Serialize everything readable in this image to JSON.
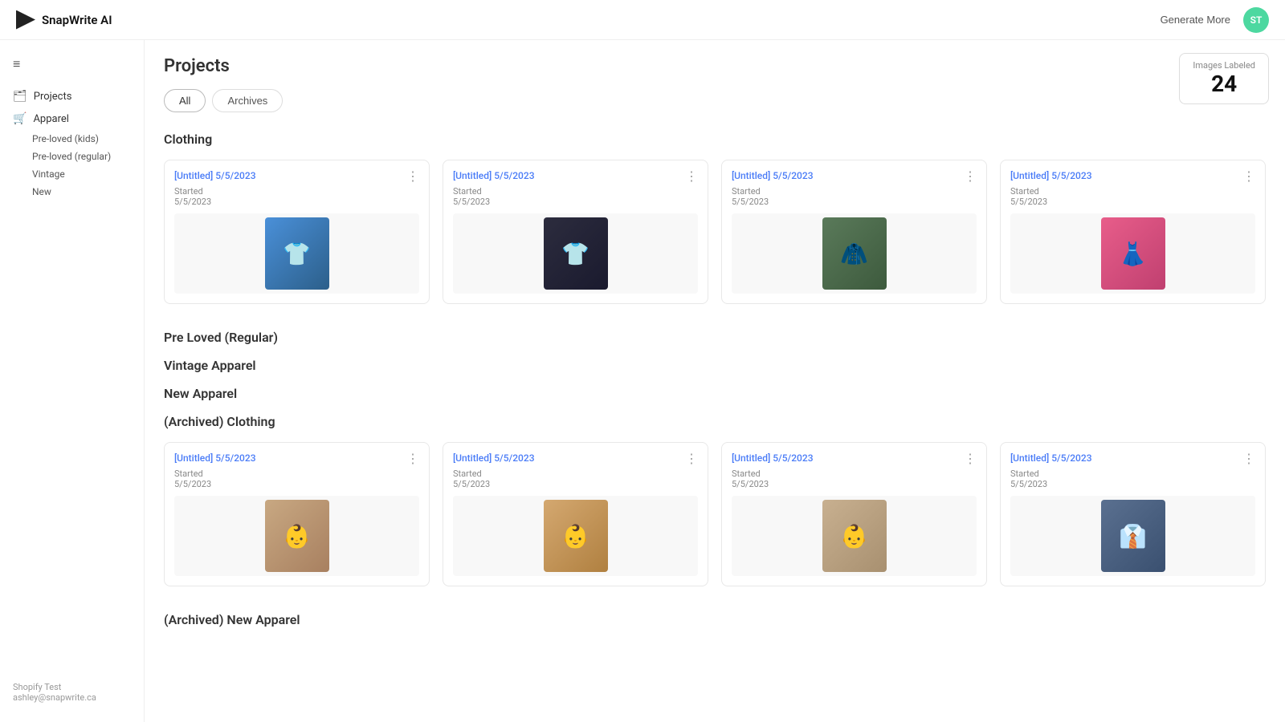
{
  "app": {
    "name": "SnapWrite AI",
    "logo_alt": "play-icon"
  },
  "header": {
    "generate_more_label": "Generate More",
    "avatar_initials": "ST"
  },
  "sidebar": {
    "menu_icon": "≡",
    "items": [
      {
        "id": "projects",
        "label": "Projects",
        "icon": "folder"
      },
      {
        "id": "apparel",
        "label": "Apparel",
        "icon": "cart"
      }
    ],
    "sub_items": [
      {
        "id": "pre-loved-kids",
        "label": "Pre-loved (kids)"
      },
      {
        "id": "pre-loved-regular",
        "label": "Pre-loved (regular)"
      },
      {
        "id": "vintage",
        "label": "Vintage"
      },
      {
        "id": "new",
        "label": "New"
      }
    ],
    "footer": {
      "store": "Shopify Test",
      "email": "ashley@snapwrite.ca"
    }
  },
  "main": {
    "page_title": "Projects",
    "tabs": [
      {
        "id": "all",
        "label": "All",
        "active": true
      },
      {
        "id": "archives",
        "label": "Archives",
        "active": false
      }
    ],
    "images_labeled": {
      "label": "Images Labeled",
      "count": "24"
    },
    "sections": [
      {
        "id": "clothing",
        "title": "Clothing",
        "projects": [
          {
            "title": "[Untitled] 5/5/2023",
            "status": "Started",
            "date": "5/5/2023",
            "img": "blue"
          },
          {
            "title": "[Untitled] 5/5/2023",
            "status": "Started",
            "date": "5/5/2023",
            "img": "dark"
          },
          {
            "title": "[Untitled] 5/5/2023",
            "status": "Started",
            "date": "5/5/2023",
            "img": "green"
          },
          {
            "title": "[Untitled] 5/5/2023",
            "status": "Started",
            "date": "5/5/2023",
            "img": "pink"
          }
        ]
      },
      {
        "id": "pre-loved-regular",
        "title": "Pre Loved (Regular)",
        "projects": []
      },
      {
        "id": "vintage-apparel",
        "title": "Vintage Apparel",
        "projects": []
      },
      {
        "id": "new-apparel",
        "title": "New Apparel",
        "projects": []
      },
      {
        "id": "archived-clothing",
        "title": "(Archived) Clothing",
        "projects": [
          {
            "title": "[Untitled] 5/5/2023",
            "status": "Started",
            "date": "5/5/2023",
            "img": "beige1"
          },
          {
            "title": "[Untitled] 5/5/2023",
            "status": "Started",
            "date": "5/5/2023",
            "img": "beige2"
          },
          {
            "title": "[Untitled] 5/5/2023",
            "status": "Started",
            "date": "5/5/2023",
            "img": "beige3"
          },
          {
            "title": "[Untitled] 5/5/2023",
            "status": "Started",
            "date": "5/5/2023",
            "img": "plaid"
          }
        ]
      },
      {
        "id": "archived-new-apparel",
        "title": "(Archived) New Apparel",
        "projects": []
      }
    ]
  }
}
